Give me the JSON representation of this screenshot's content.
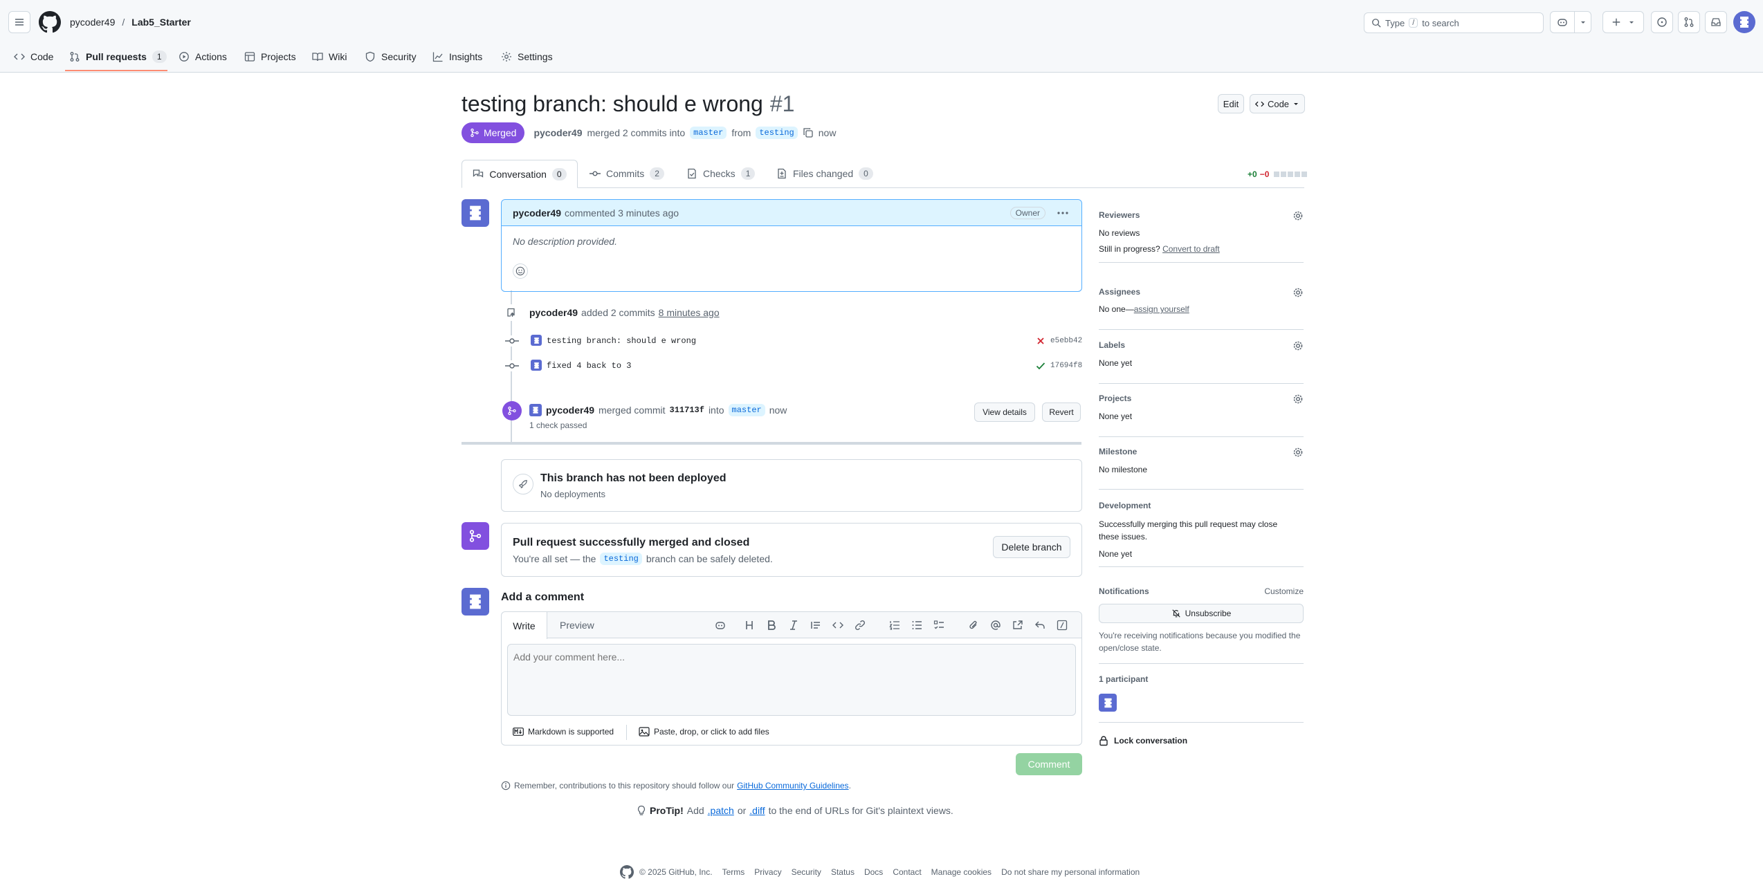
{
  "header": {
    "owner": "pycoder49",
    "sep": "/",
    "repo": "Lab5_Starter",
    "search_prefix": "Type",
    "search_key": "/",
    "search_suffix": "to search"
  },
  "tabs": [
    {
      "label": "Code"
    },
    {
      "label": "Pull requests",
      "count": "1"
    },
    {
      "label": "Actions"
    },
    {
      "label": "Projects"
    },
    {
      "label": "Wiki"
    },
    {
      "label": "Security"
    },
    {
      "label": "Insights"
    },
    {
      "label": "Settings"
    }
  ],
  "pr": {
    "title": "testing branch: should e wrong",
    "number": "#1",
    "state": "Merged",
    "author": "pycoder49",
    "merge_text": "merged 2 commits into",
    "base": "master",
    "from_text": "from",
    "head": "testing",
    "time": "now",
    "edit_label": "Edit",
    "code_label": "Code"
  },
  "pr_tabs": [
    {
      "label": "Conversation",
      "count": "0"
    },
    {
      "label": "Commits",
      "count": "2"
    },
    {
      "label": "Checks",
      "count": "1"
    },
    {
      "label": "Files changed",
      "count": "0"
    }
  ],
  "diffstat": {
    "added": "+0",
    "removed": "−0"
  },
  "comment": {
    "author": "pycoder49",
    "meta": "commented 3 minutes ago",
    "badge": "Owner",
    "body": "No description provided."
  },
  "commits_event": {
    "author": "pycoder49",
    "text": "added 2 commits",
    "time": "8 minutes ago",
    "commits": [
      {
        "message": "testing branch: should e wrong",
        "sha": "e5ebb42",
        "status": "fail"
      },
      {
        "message": "fixed 4 back to 3",
        "sha": "17694f8",
        "status": "pass"
      }
    ]
  },
  "merge_event": {
    "author": "pycoder49",
    "text": "merged commit",
    "sha": "311713f",
    "into": "into",
    "branch": "master",
    "time": "now",
    "checks": "1 check passed",
    "view_label": "View details",
    "revert_label": "Revert"
  },
  "deploy": {
    "title": "This branch has not been deployed",
    "sub": "No deployments"
  },
  "merged_box": {
    "title": "Pull request successfully merged and closed",
    "pre": "You're all set — the",
    "branch": "testing",
    "post": "branch can be safely deleted.",
    "button": "Delete branch"
  },
  "add_comment": {
    "title": "Add a comment",
    "tab_write": "Write",
    "tab_preview": "Preview",
    "placeholder": "Add your comment here...",
    "markdown": "Markdown is supported",
    "files": "Paste, drop, or click to add files",
    "submit": "Comment"
  },
  "footer_notes": {
    "guidelines_pre": "Remember, contributions to this repository should follow our",
    "guidelines_link": "GitHub Community Guidelines",
    "guidelines_post": ".",
    "protip_label": "ProTip!",
    "protip_pre": "Add",
    "patch": ".patch",
    "or": "or",
    "diff": ".diff",
    "protip_post": "to the end of URLs for Git's plaintext views."
  },
  "sidebar": {
    "reviewers": {
      "title": "Reviewers",
      "value": "No reviews",
      "progress": "Still in progress?",
      "draft": "Convert to draft"
    },
    "assignees": {
      "title": "Assignees",
      "value": "No one—",
      "link": "assign yourself"
    },
    "labels": {
      "title": "Labels",
      "value": "None yet"
    },
    "projects": {
      "title": "Projects",
      "value": "None yet"
    },
    "milestone": {
      "title": "Milestone",
      "value": "No milestone"
    },
    "development": {
      "title": "Development",
      "desc": "Successfully merging this pull request may close these issues.",
      "value": "None yet"
    },
    "notifications": {
      "title": "Notifications",
      "customize": "Customize",
      "button": "Unsubscribe",
      "desc": "You're receiving notifications because you modified the open/close state."
    },
    "participants": {
      "title": "1 participant"
    },
    "lock": "Lock conversation"
  },
  "footer": {
    "copyright": "© 2025 GitHub, Inc.",
    "links": [
      "Terms",
      "Privacy",
      "Security",
      "Status",
      "Docs",
      "Contact",
      "Manage cookies",
      "Do not share my personal information"
    ]
  },
  "colors": {
    "merged": "#8250df",
    "link": "#0969da",
    "success": "#1a7f37",
    "danger": "#d1242f",
    "comment_btn": "#94d3a2"
  }
}
